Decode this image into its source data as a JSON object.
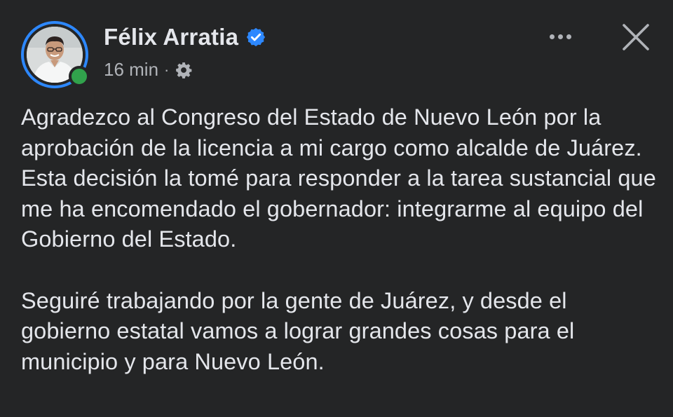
{
  "post": {
    "author": {
      "name": "Félix Arratia",
      "verified": true,
      "online": true
    },
    "meta": {
      "time": "16 min",
      "separator": "·",
      "audience_icon": "gear-icon"
    },
    "actions": {
      "more_icon": "more-options-icon",
      "close_icon": "close-icon"
    },
    "body": {
      "paragraphs": [
        "Agradezco al Congreso del Estado de Nuevo León por la aprobación de la licencia a mi cargo como alcalde de Juárez. Esta decisión la tomé para responder a la tarea sustancial que me ha encomendado el gobernador: integrarme al equipo del Gobierno del Estado.",
        "Seguiré trabajando por la gente de Juárez, y desde el gobierno estatal vamos a lograr grandes cosas para el municipio y para Nuevo León."
      ]
    }
  },
  "colors": {
    "background": "#242526",
    "text_primary": "#e4e6eb",
    "text_secondary": "#b0b3b8",
    "verified_blue": "#2d88ff",
    "online_green": "#31a24c"
  }
}
